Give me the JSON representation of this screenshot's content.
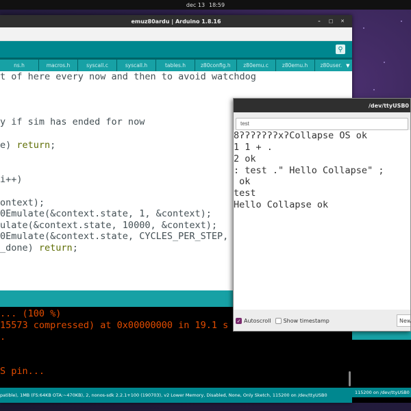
{
  "topbar": {
    "date": "dec 13",
    "time": "18:59"
  },
  "arduino": {
    "window_title": "emuz80ardu | Arduino 1.8.16",
    "tabs": [
      {
        "label": "ns.h"
      },
      {
        "label": "macros.h"
      },
      {
        "label": "syscall.c"
      },
      {
        "label": "syscall.h"
      },
      {
        "label": "tables.h"
      },
      {
        "label": "z80config.h"
      },
      {
        "label": "z80emu.c"
      },
      {
        "label": "z80emu.h"
      },
      {
        "label": "z80user."
      }
    ],
    "code": [
      {
        "a": "t of here every now and then to avoid watchdog",
        "b": "",
        "c": ""
      },
      {
        "a": "",
        "b": "",
        "c": ""
      },
      {
        "a": "",
        "b": "",
        "c": ""
      },
      {
        "a": "y if sim has ended for now",
        "b": "",
        "c": ""
      },
      {
        "a": "",
        "b": "",
        "c": ""
      },
      {
        "a": "e) ",
        "b": "return",
        "c": ";"
      },
      {
        "a": "",
        "b": "",
        "c": ""
      },
      {
        "a": "",
        "b": "",
        "c": ""
      },
      {
        "a": "i++)",
        "b": "",
        "c": ""
      },
      {
        "a": "",
        "b": "",
        "c": ""
      },
      {
        "a": "ontext);",
        "b": "",
        "c": ""
      },
      {
        "a": "0Emulate(&context.state, 1, &context);",
        "b": "",
        "c": ""
      },
      {
        "a": "ulate(&context.state, 10000, &context);",
        "b": "",
        "c": ""
      },
      {
        "a": "0Emulate(&context.state, CYCLES_PER_STEP,",
        "b": "",
        "c": ""
      },
      {
        "a": "_done) ",
        "b": "return",
        "c": ";"
      }
    ],
    "console": [
      "... (100 %)",
      "15573 compressed) at 0x00000000 in 19.1 s",
      ".",
      "",
      "",
      "S pin..."
    ],
    "footer": "patible), 1MB (FS:64KB OTA:~470KB), 2, nonos-sdk 2.2.1+100 (190703), v2 Lower Memory, Disabled, None, Only Sketch, 115200 on /dev/ttyUSB0"
  },
  "serial_monitor": {
    "title": "/dev/ttyUSB0",
    "input_value": "test",
    "output": [
      "8ʔʔʔʔʔʔʔxʔCollapse OS ok",
      "1 1 + .",
      "2 ok",
      ": test .\" Hello Collapse\" ;",
      " ok",
      "test",
      "Hello Collapse ok"
    ],
    "autoscroll_label": "Autoscroll",
    "autoscroll_checked": true,
    "timestamp_label": "Show timestamp",
    "timestamp_checked": false,
    "line_ending": "New"
  },
  "bg_window": {
    "footer": "115200 on /dev/ttyUSB0"
  },
  "colors": {
    "teal": "#00878f",
    "teal_dark": "#006468",
    "tab": "#17a1a5",
    "console_text": "#e34c00",
    "keyword": "#5e6d03"
  }
}
